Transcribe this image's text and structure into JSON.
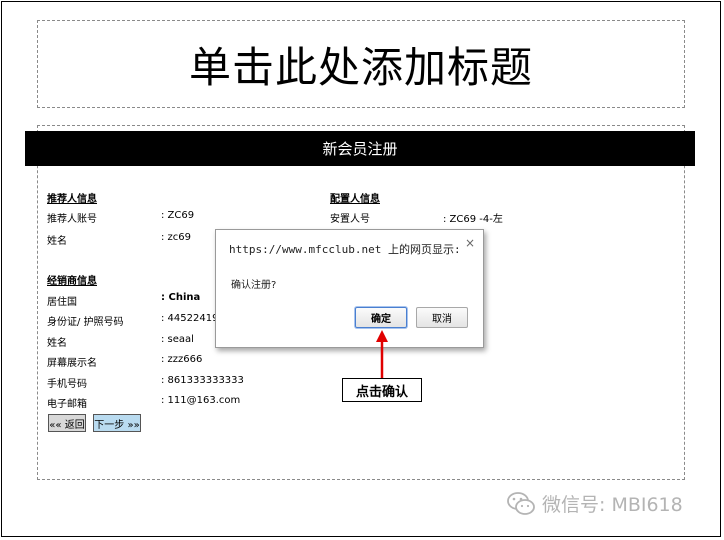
{
  "slide": {
    "title": "单击此处添加标题"
  },
  "form": {
    "header": "新会员注册",
    "referrer": {
      "section_title": "推荐人信息",
      "rows": [
        {
          "label": "推荐人账号",
          "value": ":  ZC69"
        },
        {
          "label": "姓名",
          "value": ": zc69"
        }
      ]
    },
    "placement": {
      "section_title": "配置人信息",
      "rows": [
        {
          "label": "安置人号",
          "value": ":  ZC69   -4-左"
        }
      ]
    },
    "distributor": {
      "section_title": "经销商信息",
      "rows": [
        {
          "label": "居住国",
          "value": ": China"
        },
        {
          "label": "身份证/ 护照号码",
          "value": ": 4452241999"
        },
        {
          "label": "姓名",
          "value": ": seaal"
        },
        {
          "label": "屏幕展示名",
          "value": ": zzz666"
        },
        {
          "label": "手机号码",
          "value": ": 861333333333"
        },
        {
          "label": "电子邮箱",
          "value": ": 111@163.com"
        }
      ]
    },
    "back_button": "«« 返回",
    "next_button": "下一步 »»"
  },
  "dialog": {
    "title": "https://www.mfcclub.net 上的网页显示:",
    "close_glyph": "×",
    "message": "确认注册?",
    "ok_label": "确定",
    "cancel_label": "取消"
  },
  "annotation": {
    "callout": "点击确认",
    "arrow_color": "#e00000"
  },
  "watermark": {
    "text": "微信号: MBI618",
    "icon": "wechat-icon"
  }
}
